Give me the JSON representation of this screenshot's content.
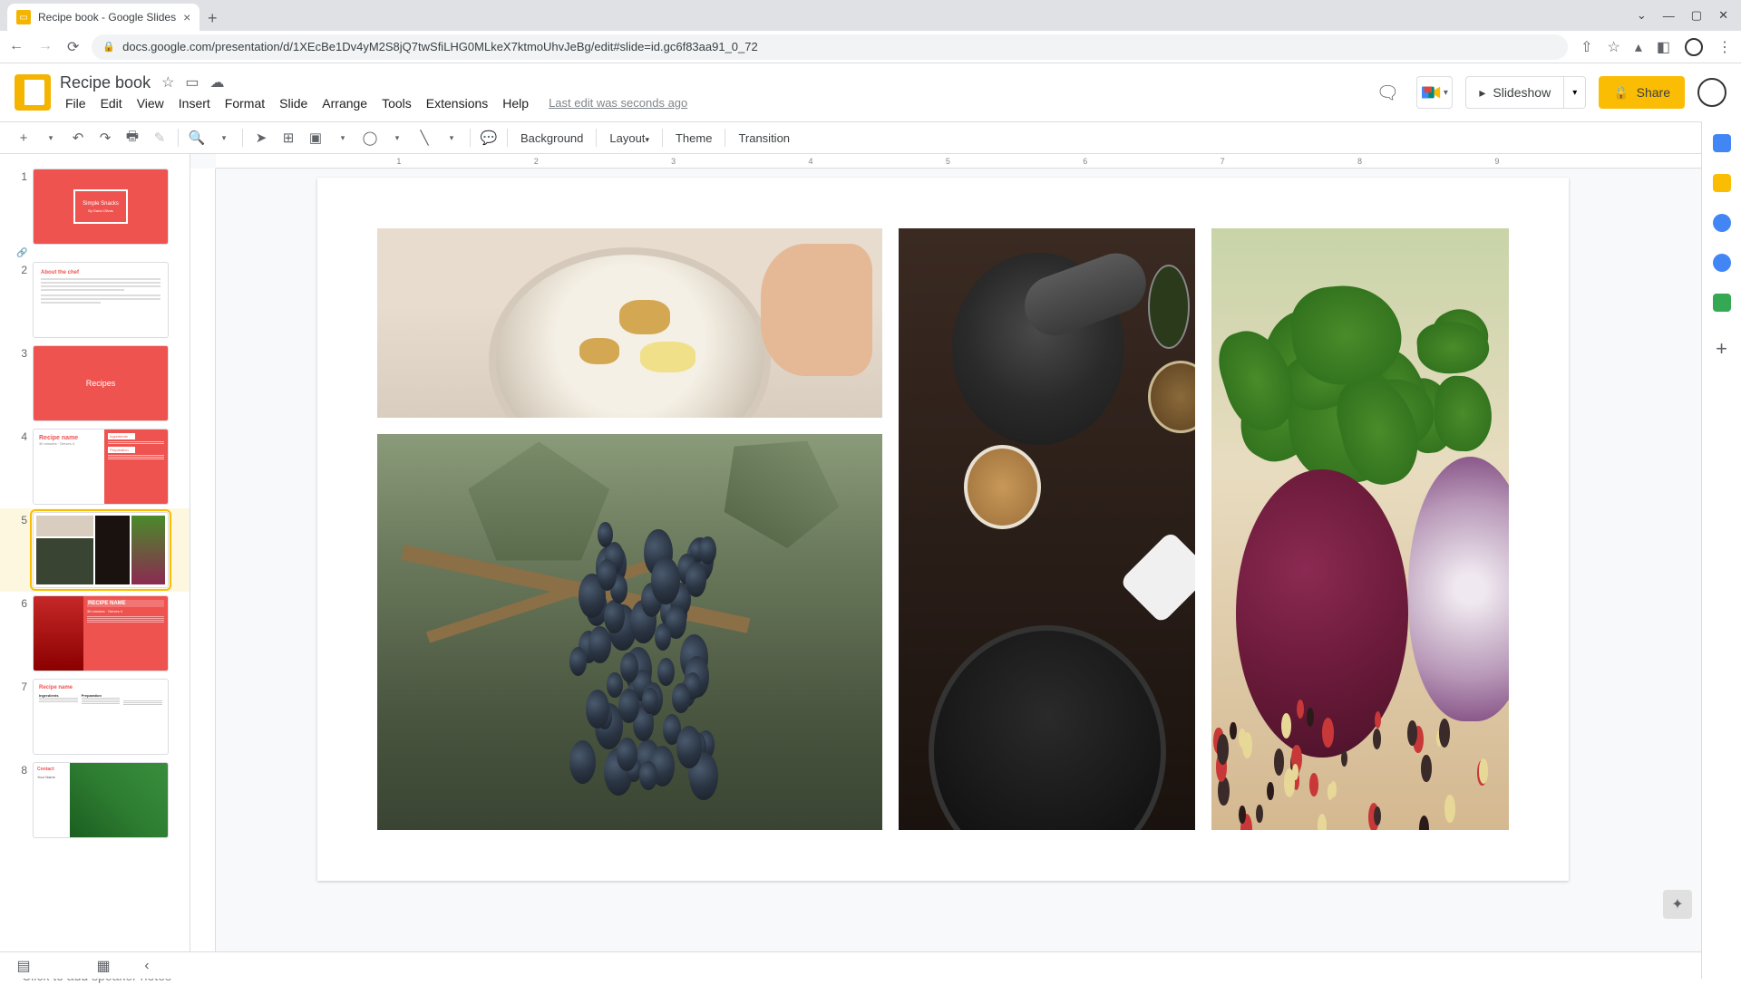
{
  "browser": {
    "tab_title": "Recipe book - Google Slides",
    "url": "docs.google.com/presentation/d/1XEcBe1Dv4yM2S8jQ7twSfiLHG0MLkeX7ktmoUhvJeBg/edit#slide=id.gc6f83aa91_0_72"
  },
  "doc": {
    "title": "Recipe book",
    "last_edit": "Last edit was seconds ago"
  },
  "menus": [
    "File",
    "Edit",
    "View",
    "Insert",
    "Format",
    "Slide",
    "Arrange",
    "Tools",
    "Extensions",
    "Help"
  ],
  "header_buttons": {
    "slideshow": "Slideshow",
    "share": "Share"
  },
  "toolbar": {
    "background": "Background",
    "layout": "Layout",
    "theme": "Theme",
    "transition": "Transition"
  },
  "ruler_labels": [
    "1",
    "2",
    "3",
    "4",
    "5",
    "6",
    "7",
    "8",
    "9"
  ],
  "thumbs": [
    {
      "n": "1",
      "title": "Simple Snacks",
      "sub": "By Dana Olivas"
    },
    {
      "n": "2",
      "title": "About the chef"
    },
    {
      "n": "3",
      "title": "Recipes"
    },
    {
      "n": "4",
      "title": "Recipe name",
      "meta": "30 minutes · Serves 4",
      "boxes": [
        "Ingredients",
        "Preparation"
      ]
    },
    {
      "n": "5"
    },
    {
      "n": "6",
      "title": "RECIPE NAME",
      "sub": "30 minutes · Serves 4"
    },
    {
      "n": "7",
      "title": "Recipe name",
      "cols": [
        "Ingredients",
        "Preparation"
      ]
    },
    {
      "n": "8",
      "title": "Contact",
      "sub": "Your Name"
    }
  ],
  "selected_thumb": 5,
  "notes_placeholder": "Click to add speaker notes"
}
